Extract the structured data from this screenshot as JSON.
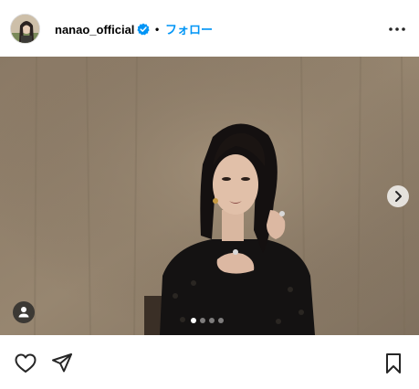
{
  "post": {
    "author": {
      "username": "nanao_official",
      "verified": true
    },
    "separator": "•",
    "follow_label": "フォロー",
    "carousel": {
      "total_slides": 4,
      "current_slide": 1
    },
    "colors": {
      "follow_blue": "#0095f6",
      "verified_blue": "#0095f6",
      "icon_color": "#262626"
    },
    "icons": {
      "more": "more-horizontal-icon",
      "next": "chevron-right-icon",
      "tag": "user-tag-icon",
      "like": "heart-icon",
      "share": "paper-plane-icon",
      "save": "bookmark-icon"
    }
  }
}
